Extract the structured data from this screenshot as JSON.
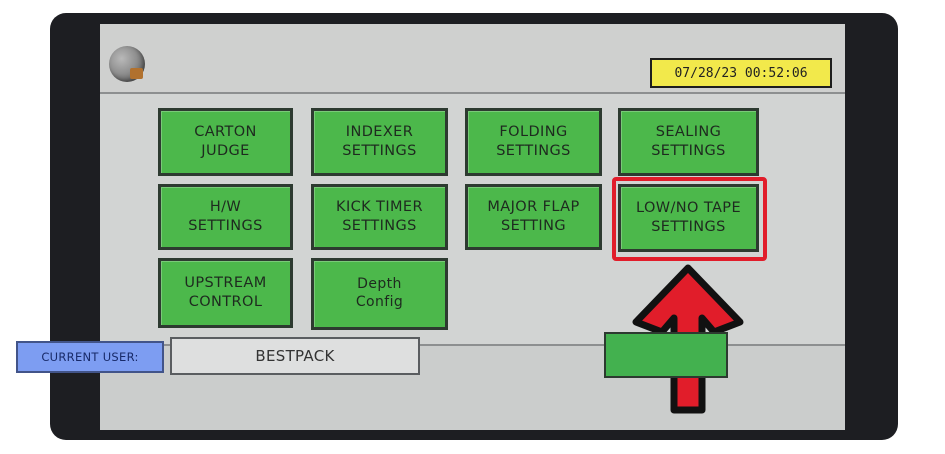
{
  "header": {
    "datetime": "07/28/23 00:52:06"
  },
  "menu": {
    "carton_judge": "CARTON\nJUDGE",
    "indexer_settings": "INDEXER\nSETTINGS",
    "folding_settings": "FOLDING\nSETTINGS",
    "sealing_settings": "SEALING\nSETTINGS",
    "hw_settings": "H/W\nSETTINGS",
    "kick_timer_settings": "KICK TIMER\nSETTINGS",
    "major_flap_setting": "MAJOR FLAP\nSETTING",
    "low_no_tape_settings": "LOW/NO TAPE\nSETTINGS",
    "upstream_control": "UPSTREAM\nCONTROL",
    "depth_config": "Depth\nConfig"
  },
  "footer": {
    "current_user_label": "CURRENT USER:",
    "current_user_value": "BESTPACK"
  },
  "colors": {
    "button_green": "#4cb84b",
    "clock_yellow": "#f2e94b",
    "highlight_red": "#e11d2a",
    "user_label_blue": "#7d9df2"
  }
}
